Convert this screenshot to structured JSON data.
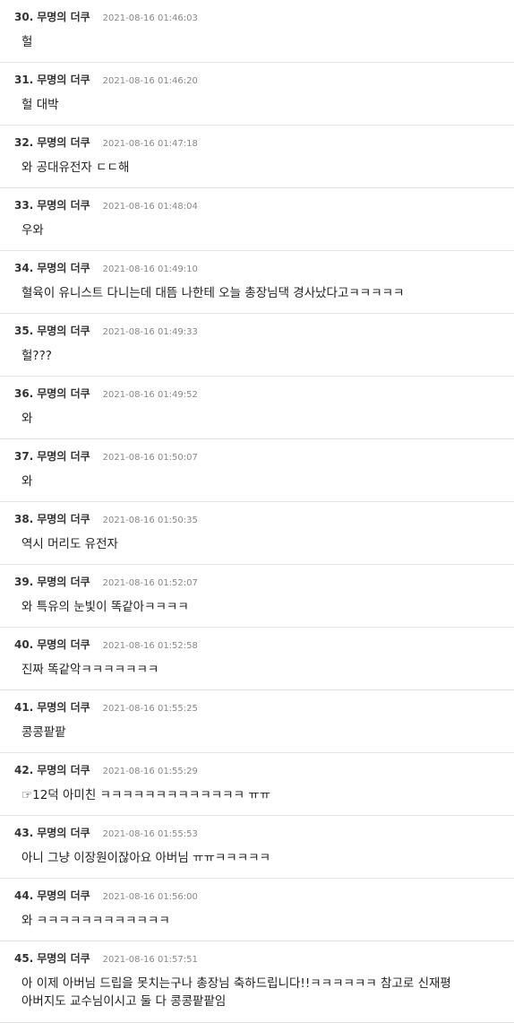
{
  "comments": [
    {
      "num": "30.",
      "author": "무명의 더쿠",
      "date": "2021-08-16 01:46:03",
      "text": "헐"
    },
    {
      "num": "31.",
      "author": "무명의 더쿠",
      "date": "2021-08-16 01:46:20",
      "text": "헐 대박"
    },
    {
      "num": "32.",
      "author": "무명의 더쿠",
      "date": "2021-08-16 01:47:18",
      "text": "와 공대유전자 ㄷㄷ해"
    },
    {
      "num": "33.",
      "author": "무명의 더쿠",
      "date": "2021-08-16 01:48:04",
      "text": "우와"
    },
    {
      "num": "34.",
      "author": "무명의 더쿠",
      "date": "2021-08-16 01:49:10",
      "text": "혈육이 유니스트 다니는데 대뜸 나한테 오늘 총장님댁 경사났다고ㅋㅋㅋㅋㅋ"
    },
    {
      "num": "35.",
      "author": "무명의 더쿠",
      "date": "2021-08-16 01:49:33",
      "text": "헐???"
    },
    {
      "num": "36.",
      "author": "무명의 더쿠",
      "date": "2021-08-16 01:49:52",
      "text": "와"
    },
    {
      "num": "37.",
      "author": "무명의 더쿠",
      "date": "2021-08-16 01:50:07",
      "text": "와"
    },
    {
      "num": "38.",
      "author": "무명의 더쿠",
      "date": "2021-08-16 01:50:35",
      "text": "역시 머리도 유전자"
    },
    {
      "num": "39.",
      "author": "무명의 더쿠",
      "date": "2021-08-16 01:52:07",
      "text": "와 특유의 눈빛이 똑같아ㅋㅋㅋㅋ"
    },
    {
      "num": "40.",
      "author": "무명의 더쿠",
      "date": "2021-08-16 01:52:58",
      "text": "진짜 똑같악ㅋㅋㅋㅋㅋㅋㅋ"
    },
    {
      "num": "41.",
      "author": "무명의 더쿠",
      "date": "2021-08-16 01:55:25",
      "text": "콩콩팥팥"
    },
    {
      "num": "42.",
      "author": "무명의 더쿠",
      "date": "2021-08-16 01:55:29",
      "text": "☞12덕 아미친 ㅋㅋㅋㅋㅋㅋㅋㅋㅋㅋㅋㅋㅋ ㅠㅠ"
    },
    {
      "num": "43.",
      "author": "무명의 더쿠",
      "date": "2021-08-16 01:55:53",
      "text": "아니 그냥 이장원이잖아요 아버님 ㅠㅠㅋㅋㅋㅋㅋ"
    },
    {
      "num": "44.",
      "author": "무명의 더쿠",
      "date": "2021-08-16 01:56:00",
      "text": "와 ㅋㅋㅋㅋㅋㅋㅋㅋㅋㅋㅋㅋ"
    },
    {
      "num": "45.",
      "author": "무명의 더쿠",
      "date": "2021-08-16 01:57:51",
      "text": "아 이제 아버님 드립을 못치는구나 총장님 축하드립니다!!ㅋㅋㅋㅋㅋㅋ 참고로 신재평 아버지도 교수님이시고 둘 다 콩콩팥팥임"
    }
  ]
}
